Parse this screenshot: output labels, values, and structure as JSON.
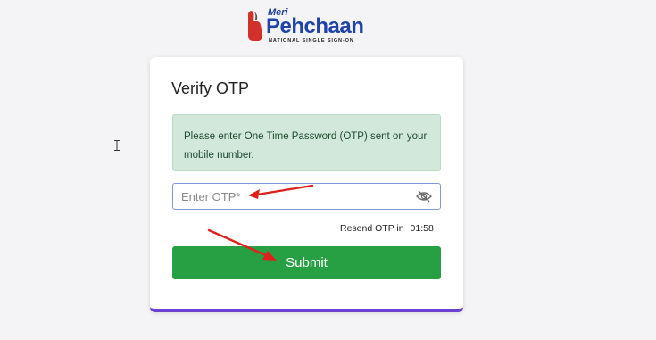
{
  "logo": {
    "line1": "Meri",
    "line2": "Pehchaan",
    "tagline": "NATIONAL SINGLE SIGN-ON"
  },
  "card": {
    "title": "Verify OTP",
    "alert_text": "Please enter One Time Password (OTP) sent on your mobile number.",
    "otp_input": {
      "placeholder": "Enter OTP*",
      "value": ""
    },
    "eye_icon": "eye-slash-icon",
    "resend_label": "Resend OTP in",
    "resend_timer": "01:58",
    "submit_label": "Submit"
  },
  "colors": {
    "submit_bg": "#26a043",
    "alert_bg": "#d2e8da",
    "card_border_accent": "#6a3fd1",
    "annotation_arrow": "#e0201b",
    "brand_blue": "#2043a8"
  }
}
